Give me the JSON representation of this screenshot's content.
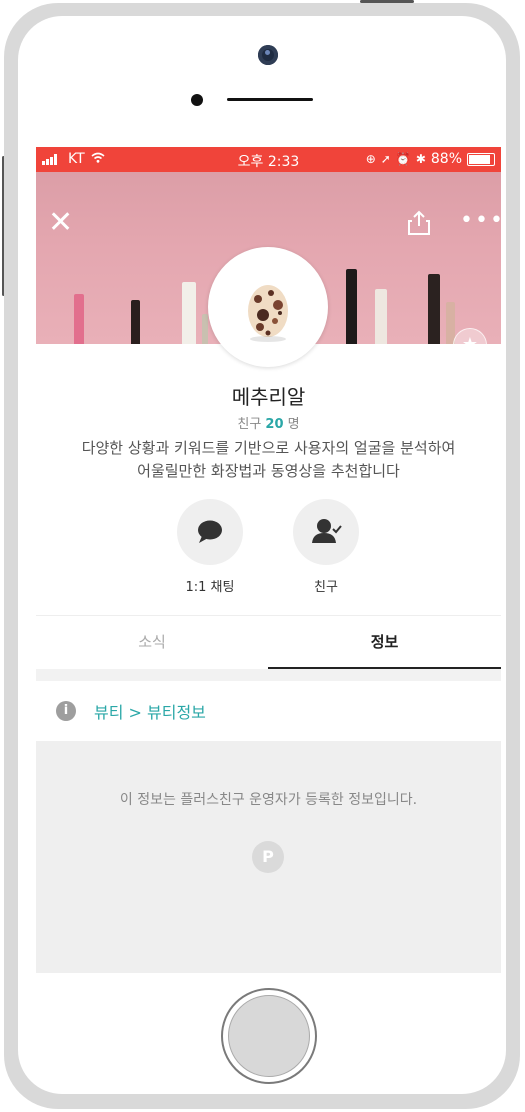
{
  "statusbar": {
    "carrier": "KT",
    "time": "오후 2:33",
    "battery": "88%"
  },
  "profile": {
    "name": "메추리알",
    "friends_prefix": "친구",
    "friends_count": "20",
    "friends_suffix": "명",
    "description_line1": "다양한 상황과 키워드를 기반으로 사용자의 얼굴을 분석하여",
    "description_line2": "어울릴만한 화장법과 동영상을 추천합니다"
  },
  "actions": {
    "chat_label": "1:1 채팅",
    "friend_label": "친구"
  },
  "tabs": {
    "news": "소식",
    "info": "정보",
    "selected": "정보"
  },
  "category": {
    "breadcrumb": "뷰티 > 뷰티정보"
  },
  "info": {
    "notice": "이 정보는 플러스친구 운영자가 등록한 정보입니다."
  },
  "colors": {
    "statusbar": "#f0443a",
    "accent": "#2aa7a7",
    "cover": "#e4a7b0"
  },
  "icons": [
    "close-icon",
    "share-icon",
    "more-icon",
    "star-icon",
    "chat-bubble-icon",
    "friend-check-icon",
    "info-icon",
    "plus-friend-logo-icon"
  ]
}
